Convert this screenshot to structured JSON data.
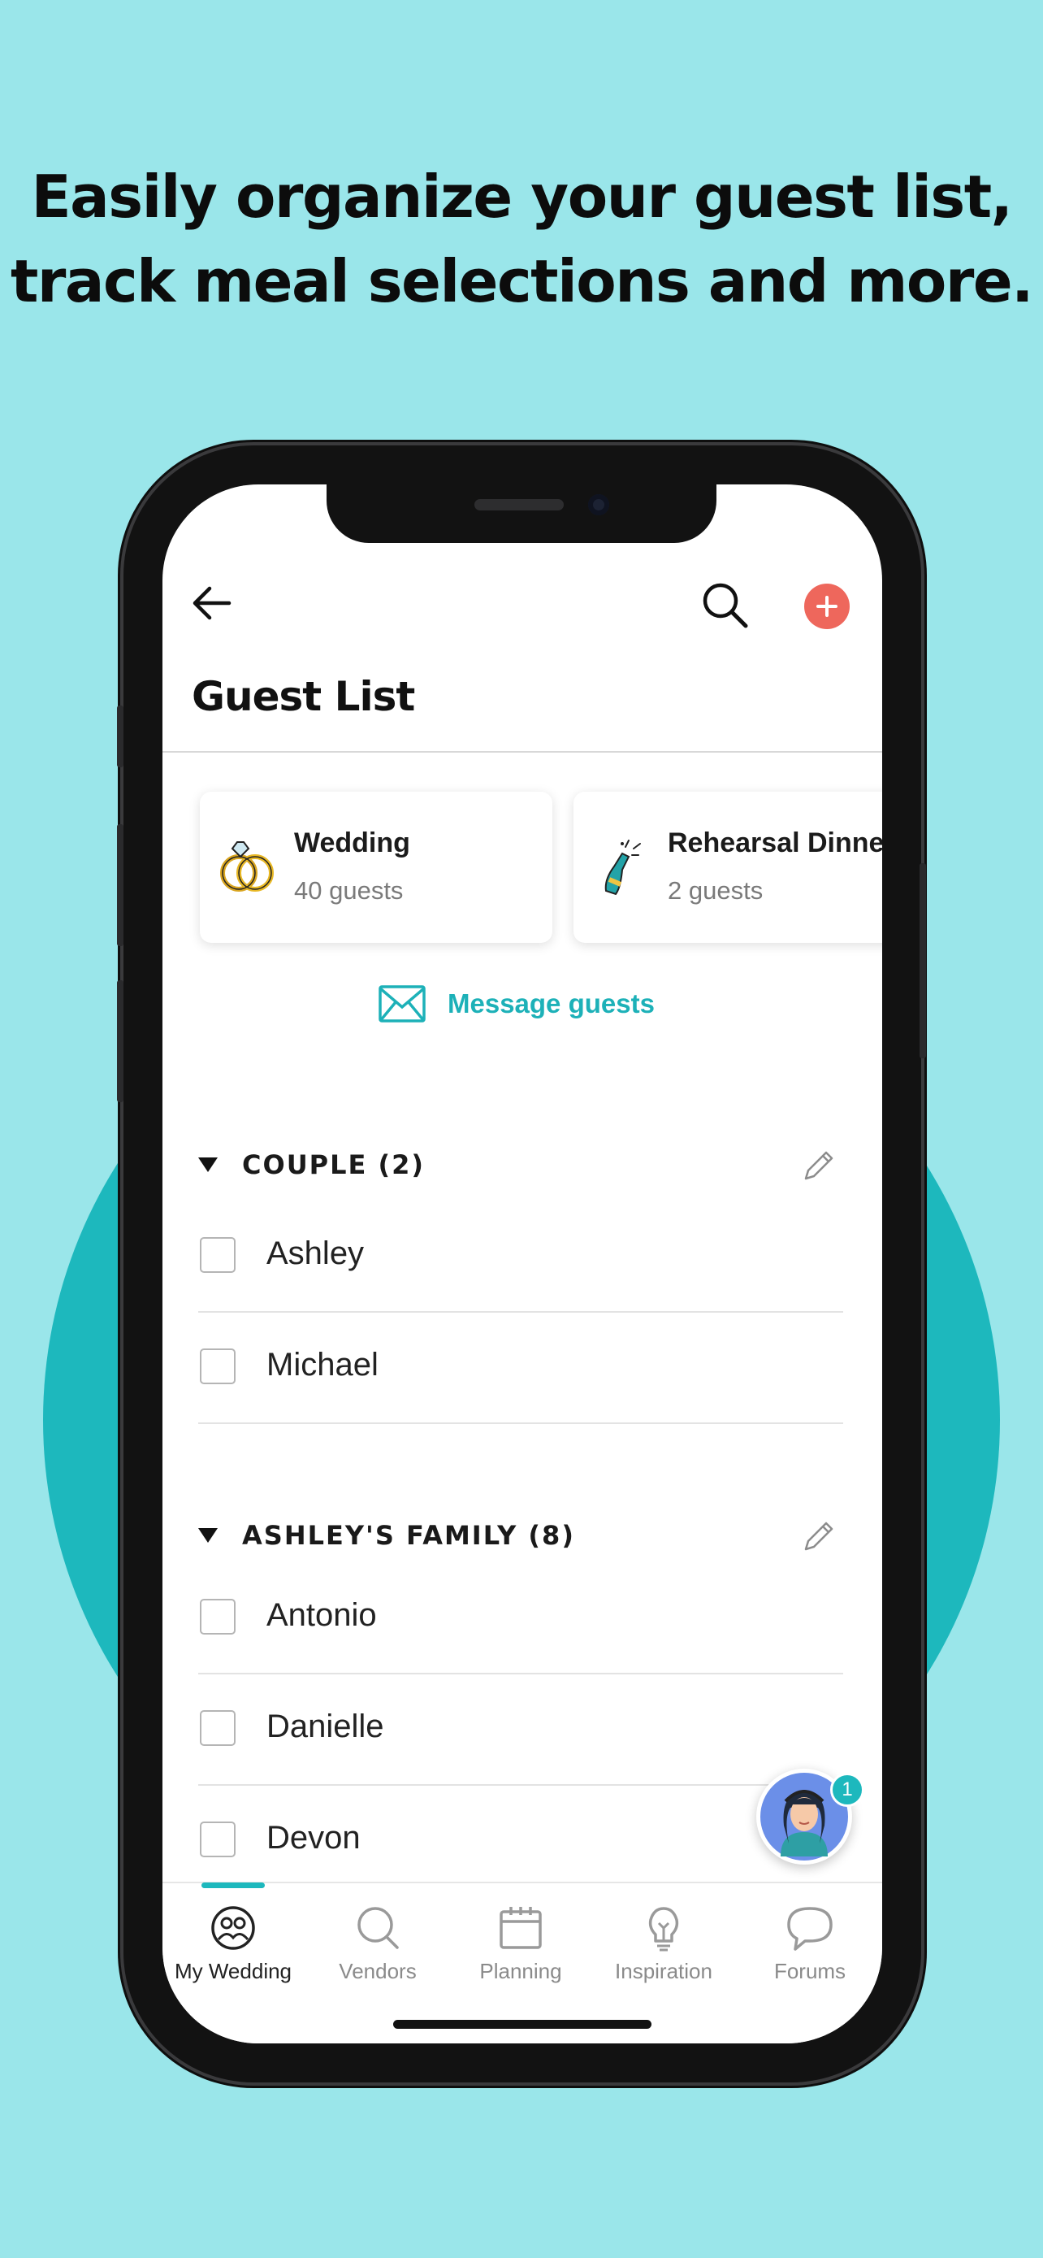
{
  "promo": {
    "headline_line1": "Easily organize your guest list,",
    "headline_line2": "track meal selections and more."
  },
  "header": {
    "title": "Guest List",
    "back_icon": "arrow-left-icon",
    "search_icon": "search-icon",
    "add_icon": "plus-circle-icon"
  },
  "events": [
    {
      "name": "Wedding",
      "count": "40 guests",
      "icon": "wedding-rings-icon"
    },
    {
      "name": "Rehearsal Dinner",
      "count": "2 guests",
      "icon": "champagne-bottle-icon"
    }
  ],
  "message": {
    "label": "Message guests",
    "icon": "envelope-icon"
  },
  "groups": [
    {
      "title": "COUPLE (2)",
      "guests": [
        "Ashley",
        "Michael"
      ]
    },
    {
      "title": "ASHLEY'S FAMILY (8)",
      "guests": [
        "Antonio",
        "Danielle",
        "Devon"
      ]
    }
  ],
  "assistant": {
    "badge": "1"
  },
  "nav": [
    {
      "label": "My Wedding",
      "icon": "my-wedding-icon",
      "active": true
    },
    {
      "label": "Vendors",
      "icon": "search-icon"
    },
    {
      "label": "Planning",
      "icon": "calendar-icon"
    },
    {
      "label": "Inspiration",
      "icon": "lightbulb-icon"
    },
    {
      "label": "Forums",
      "icon": "chat-bubble-icon"
    }
  ],
  "colors": {
    "background": "#9ae6ea",
    "accent": "#1db8bd",
    "add_button": "#ee675c"
  }
}
